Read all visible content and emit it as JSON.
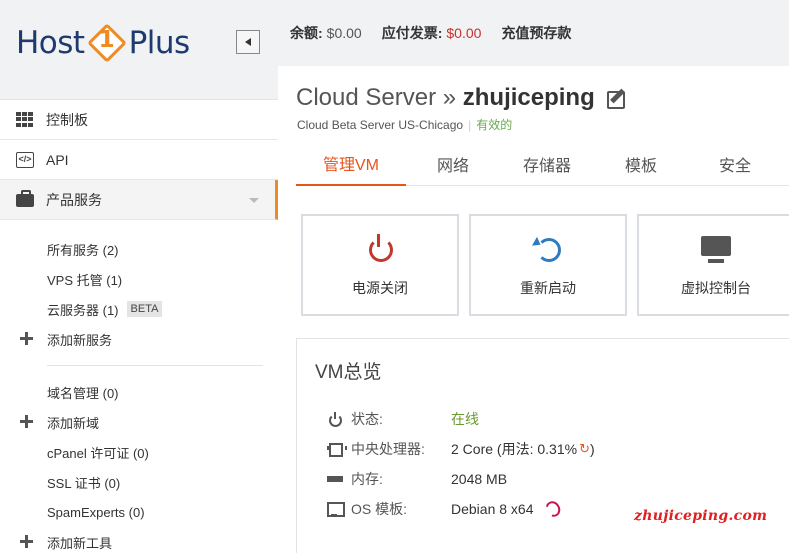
{
  "brand": {
    "left": "Host",
    "number": "1",
    "right": "Plus",
    "accent_color": "#f08a24"
  },
  "sidebar": {
    "collapse_icon": "chevron-left-icon",
    "nav": [
      {
        "label": "控制板",
        "icon": "grid-icon"
      },
      {
        "label": "API",
        "icon": "api-icon"
      },
      {
        "label": "产品服务",
        "icon": "briefcase-icon"
      }
    ],
    "services": [
      {
        "label": "所有服务 (2)"
      },
      {
        "label": "VPS 托管 (1)"
      },
      {
        "label": "云服务器 (1)",
        "badge": "BETA"
      },
      {
        "label": "添加新服务",
        "icon": "plus-icon"
      }
    ],
    "domains": [
      {
        "label": "域名管理 (0)"
      },
      {
        "label": "添加新域",
        "icon": "plus-icon"
      },
      {
        "label": "cPanel 许可证 (0)"
      },
      {
        "label": "SSL 证书 (0)"
      },
      {
        "label": "SpamExperts (0)"
      },
      {
        "label": "添加新工具",
        "icon": "plus-icon"
      }
    ]
  },
  "topbar": {
    "balance_label": "余额:",
    "balance_value": "$0.00",
    "invoice_label": "应付发票:",
    "invoice_value": "$0.00",
    "recharge_label": "充值预存款"
  },
  "server": {
    "title_prefix": "Cloud Server »",
    "name": "zhujiceping",
    "subtitle": "Cloud Beta Server US-Chicago",
    "status": "有效的"
  },
  "tabs": [
    "管理VM",
    "网络",
    "存储器",
    "模板",
    "安全"
  ],
  "actions": [
    {
      "label": "电源关闭",
      "icon": "power-icon",
      "color": "#c0392b"
    },
    {
      "label": "重新启动",
      "icon": "restart-icon",
      "color": "#2f7bbf"
    },
    {
      "label": "虚拟控制台",
      "icon": "monitor-icon",
      "color": "#555555"
    }
  ],
  "overview": {
    "title": "VM总览",
    "rows": [
      {
        "label": "状态:",
        "value": "在线",
        "icon": "power-icon"
      },
      {
        "label": "中央处理器:",
        "value": "2 Core (用法: 0.31%",
        "value_suffix": ")",
        "icon": "cpu-icon"
      },
      {
        "label": "内存:",
        "value": "2048 MB",
        "icon": "memory-icon"
      },
      {
        "label": "OS 模板:",
        "value": "Debian 8 x64",
        "icon": "os-icon"
      }
    ]
  },
  "watermark": "zhujiceping.com"
}
